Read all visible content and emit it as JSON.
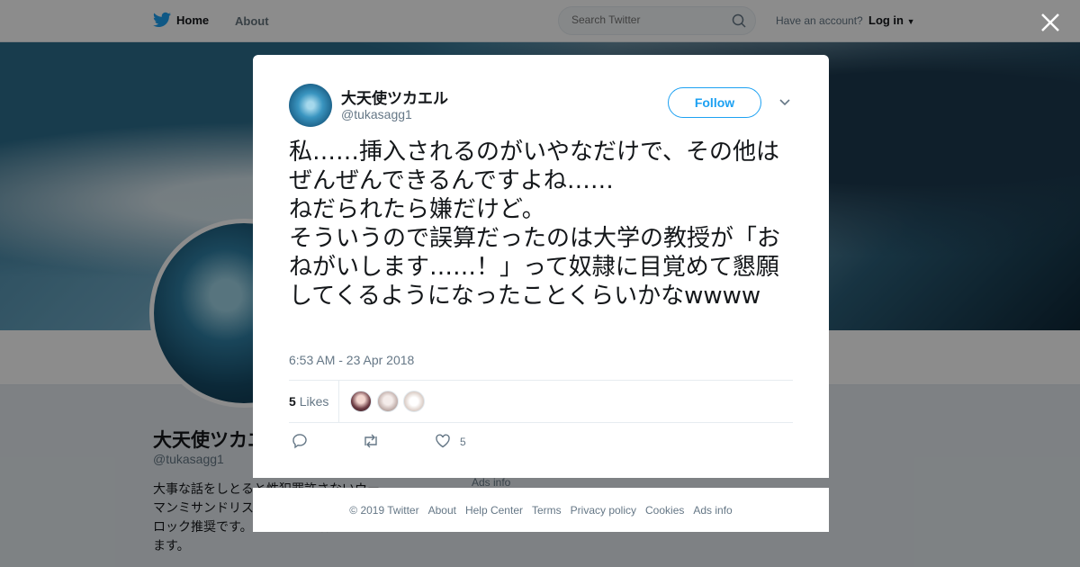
{
  "topbar": {
    "home_label": "Home",
    "about_label": "About",
    "search_placeholder": "Search Twitter",
    "have_account": "Have an account?",
    "login_label": "Log in"
  },
  "profile": {
    "name": "大天使ツカエル",
    "handle": "@tukasagg1",
    "bio": "大事な話をしとると性犯罪許さないウーマンミサンドリス…んしますので、合…ロック推奨です。よろしくお願いいたします。",
    "ads_info": "Ads info"
  },
  "tweet": {
    "author_name": "大天使ツカエル",
    "author_handle": "@tukasagg1",
    "follow_label": "Follow",
    "text": "私……挿入されるのがいやなだけで、その他はぜんぜんできるんですよね……\nねだられたら嫌だけど。\nそういうので誤算だったのは大学の教授が「おねがいします……！」って奴隷に目覚めて懇願してくるようになったことくらいかなwwww",
    "timestamp": "6:53 AM - 23 Apr 2018",
    "likes_count": "5",
    "likes_label": "Likes",
    "like_action_count": "5"
  },
  "footer": {
    "links": [
      "© 2019 Twitter",
      "About",
      "Help Center",
      "Terms",
      "Privacy policy",
      "Cookies",
      "Ads info"
    ]
  },
  "colors": {
    "accent": "#1da1f2",
    "text_primary": "#14171a",
    "text_secondary": "#657786"
  }
}
